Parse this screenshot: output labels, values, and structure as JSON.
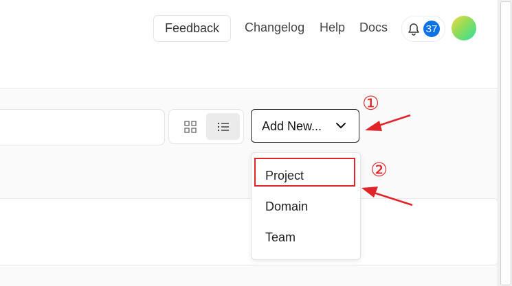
{
  "header": {
    "feedback_label": "Feedback",
    "links": [
      "Changelog",
      "Help",
      "Docs"
    ],
    "notifications_count": "37"
  },
  "toolbar": {
    "search": {
      "value": "",
      "placeholder": ""
    },
    "view_modes": [
      "grid",
      "list"
    ],
    "active_view": "list",
    "add_new_label": "Add New..."
  },
  "add_new_menu": {
    "items": [
      "Project",
      "Domain",
      "Team"
    ],
    "highlighted": "Project"
  },
  "annotations": {
    "step1": "①",
    "step2": "②",
    "color": "#e0242a"
  },
  "colors": {
    "badge": "#0b72e7",
    "active_toggle": "#ebebeb",
    "annotation": "#e0242a"
  },
  "icons": [
    "bell-icon",
    "grid-view-icon",
    "list-view-icon",
    "chevron-down-icon"
  ]
}
